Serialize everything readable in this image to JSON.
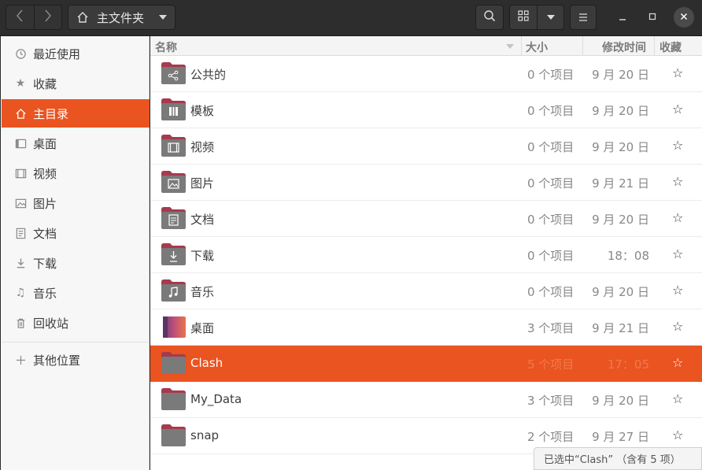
{
  "header": {
    "path_label": "主文件夹",
    "icons": {
      "back": "chevron-left-icon",
      "forward": "chevron-right-icon",
      "home": "home-icon",
      "search": "search-icon",
      "view_grid": "grid-view-icon",
      "view_options": "chevron-down-icon",
      "menu": "hamburger-menu-icon",
      "minimize": "minimize-icon",
      "maximize": "maximize-icon",
      "close": "close-icon"
    }
  },
  "sidebar": {
    "items": [
      {
        "label": "最近使用",
        "icon": "clock-icon"
      },
      {
        "label": "收藏",
        "icon": "star-icon"
      },
      {
        "label": "主目录",
        "icon": "home-icon",
        "active": true
      },
      {
        "label": "桌面",
        "icon": "desktop-icon"
      },
      {
        "label": "视频",
        "icon": "video-icon"
      },
      {
        "label": "图片",
        "icon": "picture-icon"
      },
      {
        "label": "文档",
        "icon": "document-icon"
      },
      {
        "label": "下载",
        "icon": "download-icon"
      },
      {
        "label": "音乐",
        "icon": "music-icon"
      },
      {
        "label": "回收站",
        "icon": "trash-icon"
      },
      {
        "label": "其他位置",
        "icon": "plus-icon"
      }
    ]
  },
  "columns": {
    "name": "名称",
    "size": "大小",
    "modified": "修改时间",
    "starred": "收藏"
  },
  "files": [
    {
      "name": "公共的",
      "size": "0 个项目",
      "date": "9 月 20 日",
      "emblem": "share-icon"
    },
    {
      "name": "模板",
      "size": "0 个项目",
      "date": "9 月 20 日",
      "emblem": "template-icon"
    },
    {
      "name": "视频",
      "size": "0 个项目",
      "date": "9 月 20 日",
      "emblem": "video-icon"
    },
    {
      "name": "图片",
      "size": "0 个项目",
      "date": "9 月 21 日",
      "emblem": "picture-icon"
    },
    {
      "name": "文档",
      "size": "0 个项目",
      "date": "9 月 20 日",
      "emblem": "document-icon"
    },
    {
      "name": "下载",
      "size": "0 个项目",
      "date": "18：08",
      "emblem": "download-icon"
    },
    {
      "name": "音乐",
      "size": "0 个项目",
      "date": "9 月 20 日",
      "emblem": "music-icon"
    },
    {
      "name": "桌面",
      "size": "3 个项目",
      "date": "9 月 21 日",
      "emblem": "desktop-icon"
    },
    {
      "name": "Clash",
      "size": "5 个项目",
      "date": "17：05",
      "emblem": "",
      "selected": true
    },
    {
      "name": "My_Data",
      "size": "3 个项目",
      "date": "9 月 20 日",
      "emblem": ""
    },
    {
      "name": "snap",
      "size": "2 个项目",
      "date": "9 月 27 日",
      "emblem": ""
    }
  ],
  "status": "已选中“Clash” （含有 5 项）",
  "colors": {
    "accent": "#e95420",
    "folder_body": "#7a7a7a",
    "folder_tab": "#a63a4e"
  }
}
